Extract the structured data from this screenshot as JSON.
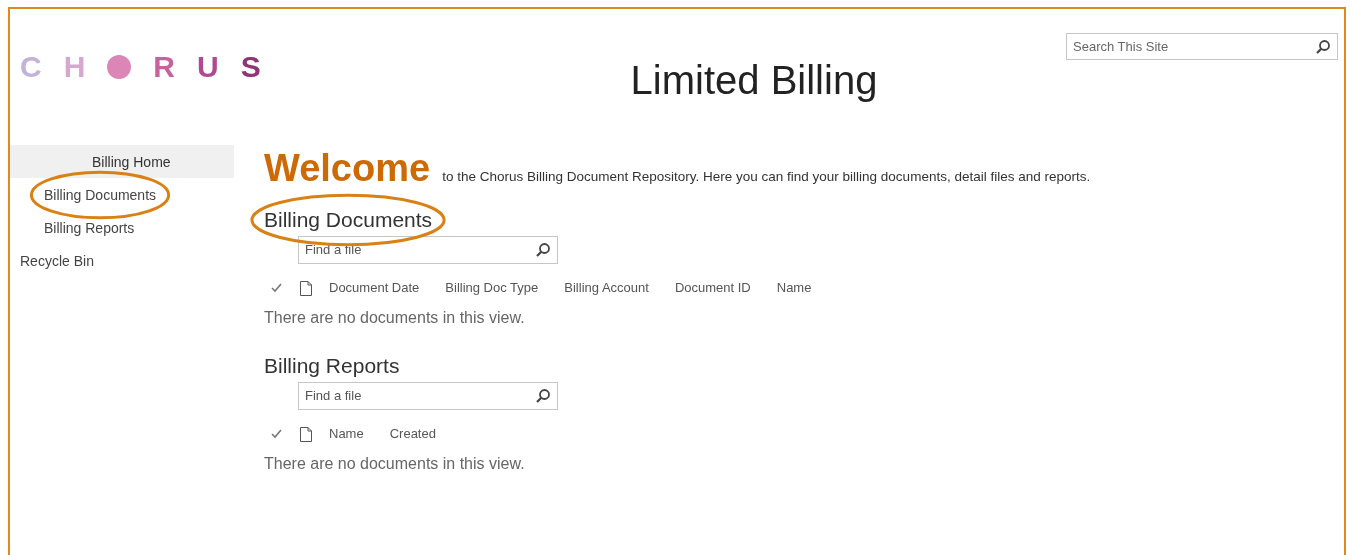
{
  "logo": [
    {
      "kind": "letter",
      "text": "C",
      "color": "#c4b3d9"
    },
    {
      "kind": "letter",
      "text": "H",
      "color": "#d5a8d0"
    },
    {
      "kind": "dot",
      "color": "#dc86b8"
    },
    {
      "kind": "letter",
      "text": "R",
      "color": "#c8629e"
    },
    {
      "kind": "letter",
      "text": "U",
      "color": "#b04a8e"
    },
    {
      "kind": "letter",
      "text": "S",
      "color": "#8f3576"
    }
  ],
  "site_title": "Limited Billing",
  "search": {
    "placeholder": "Search This Site"
  },
  "nav": [
    {
      "label": "Billing Home",
      "selected": true,
      "circled": false,
      "children": [
        {
          "label": "Billing Documents",
          "selected": false,
          "circled": true
        },
        {
          "label": "Billing Reports",
          "selected": false,
          "circled": false
        }
      ]
    },
    {
      "label": "Recycle Bin",
      "selected": false,
      "circled": false
    }
  ],
  "welcome": {
    "heading": "Welcome",
    "text": "to the Chorus Billing Document Repository. Here you can find your billing documents, detail files and reports."
  },
  "sections": [
    {
      "title": "Billing Documents",
      "circled": true,
      "search_placeholder": "Find a file",
      "columns": [
        "Document Date",
        "Billing Doc Type",
        "Billing Account",
        "Document ID",
        "Name"
      ],
      "empty_text": "There are no documents in this view."
    },
    {
      "title": "Billing Reports",
      "circled": false,
      "search_placeholder": "Find a file",
      "columns": [
        "Name",
        "Created"
      ],
      "empty_text": "There are no documents in this view."
    }
  ]
}
